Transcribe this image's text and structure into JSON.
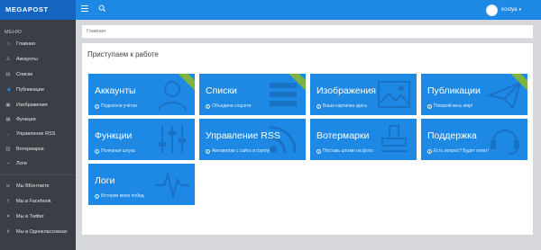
{
  "app": {
    "brand": "MEGAPOST"
  },
  "header": {
    "user_name": "kostya"
  },
  "sidebar": {
    "menu_title": "МЕНЮ",
    "items": [
      {
        "label": "Главная",
        "icon": "home-icon"
      },
      {
        "label": "Аккаунты",
        "icon": "user-icon"
      },
      {
        "label": "Списки",
        "icon": "list-icon"
      },
      {
        "label": "Публикации",
        "icon": "publish-icon"
      },
      {
        "label": "Изображения",
        "icon": "image-icon"
      },
      {
        "label": "Функции",
        "icon": "function-icon"
      },
      {
        "label": "Управление RSS",
        "icon": "rss-icon"
      },
      {
        "label": "Вотермарки",
        "icon": "watermark-icon"
      },
      {
        "label": "Логи",
        "icon": "logs-icon"
      }
    ],
    "social": [
      {
        "label": "Мы ВКонтакте",
        "icon": "vk-icon"
      },
      {
        "label": "Мы в Facebook",
        "icon": "facebook-icon"
      },
      {
        "label": "Мы в Twitter",
        "icon": "twitter-icon"
      },
      {
        "label": "Мы в Одноклассниках",
        "icon": "odnoklassniki-icon"
      }
    ]
  },
  "breadcrumb": {
    "current": "Главная"
  },
  "panel": {
    "title": "Приступаем к работе"
  },
  "tiles": [
    {
      "title": "Аккаунты",
      "subtitle": "Подключи учётки",
      "art": "user-art",
      "ribbon": true
    },
    {
      "title": "Списки",
      "subtitle": "Объедини соцсети",
      "art": "list-art",
      "ribbon": true
    },
    {
      "title": "Изображения",
      "subtitle": "Ваша картинка здесь",
      "art": "image-art",
      "ribbon": false
    },
    {
      "title": "Публикации",
      "subtitle": "Покоряй весь мир!",
      "art": "publish-art",
      "ribbon": true
    },
    {
      "title": "Функции",
      "subtitle": "Полезная штука",
      "art": "sliders-art",
      "ribbon": false
    },
    {
      "title": "Управление RSS",
      "subtitle": "Автоматом с сайта в группу",
      "art": "rss-art",
      "ribbon": false
    },
    {
      "title": "Вотермарки",
      "subtitle": "Поставь штамп на фото",
      "art": "stamp-art",
      "ribbon": false
    },
    {
      "title": "Поддержка",
      "subtitle": "Есть вопрос? Будет ответ!",
      "art": "headset-art",
      "ribbon": false
    },
    {
      "title": "Логи",
      "subtitle": "История моих побед",
      "art": "pulse-art",
      "ribbon": false
    }
  ],
  "colors": {
    "topbar": "#1e88e5",
    "brand_bg": "#1565c0",
    "sidebar_bg": "#3b3f45",
    "tile_bg": "#1e88e5",
    "ribbon": "#7cb342",
    "content_bg": "#d6d8db"
  }
}
